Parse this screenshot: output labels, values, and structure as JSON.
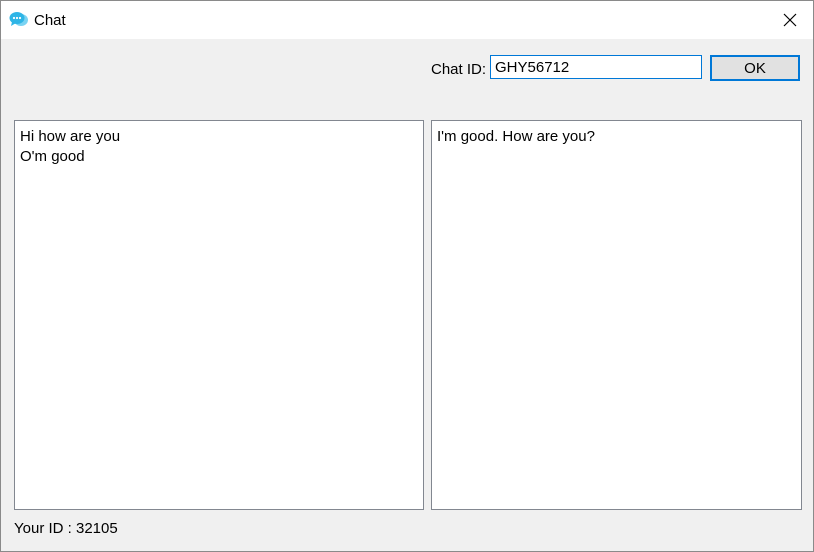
{
  "window": {
    "title": "Chat",
    "app_icon": "chat-bubbles-icon",
    "close_icon": "close-icon"
  },
  "chat_id": {
    "label": "Chat ID:",
    "value": "GHY56712",
    "button_label": "OK"
  },
  "left_pane": {
    "messages": [
      "Hi how are you",
      "O'm good"
    ]
  },
  "right_pane": {
    "messages": [
      "I'm good. How are you?"
    ]
  },
  "footer": {
    "your_id_text": "Your ID : 32105"
  },
  "colors": {
    "accent": "#0078d7",
    "icon_primary": "#2fb5e6",
    "icon_secondary": "#7ad3f2"
  }
}
